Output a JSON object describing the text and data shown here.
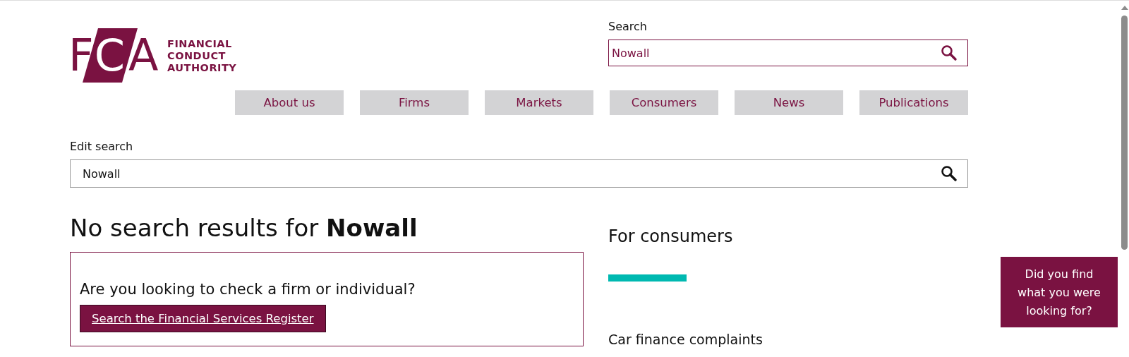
{
  "logo": {
    "letters": "FCA",
    "wordmark": [
      "FINANCIAL",
      "CONDUCT",
      "AUTHORITY"
    ]
  },
  "header_search": {
    "label": "Search",
    "value": "Nowall"
  },
  "nav": [
    {
      "label": "About us"
    },
    {
      "label": "Firms"
    },
    {
      "label": "Markets"
    },
    {
      "label": "Consumers"
    },
    {
      "label": "News"
    },
    {
      "label": "Publications"
    }
  ],
  "edit_search": {
    "label": "Edit search",
    "value": "Nowall"
  },
  "heading": "No search results for **Nowall**",
  "register_box": {
    "question": "Are you looking to check a firm or individual?",
    "button": "Search the Financial Services Register"
  },
  "sidebar": {
    "title": "For consumers",
    "links": [
      "Car finance complaints"
    ]
  },
  "feedback_button": "Did you find what you were looking for?"
}
